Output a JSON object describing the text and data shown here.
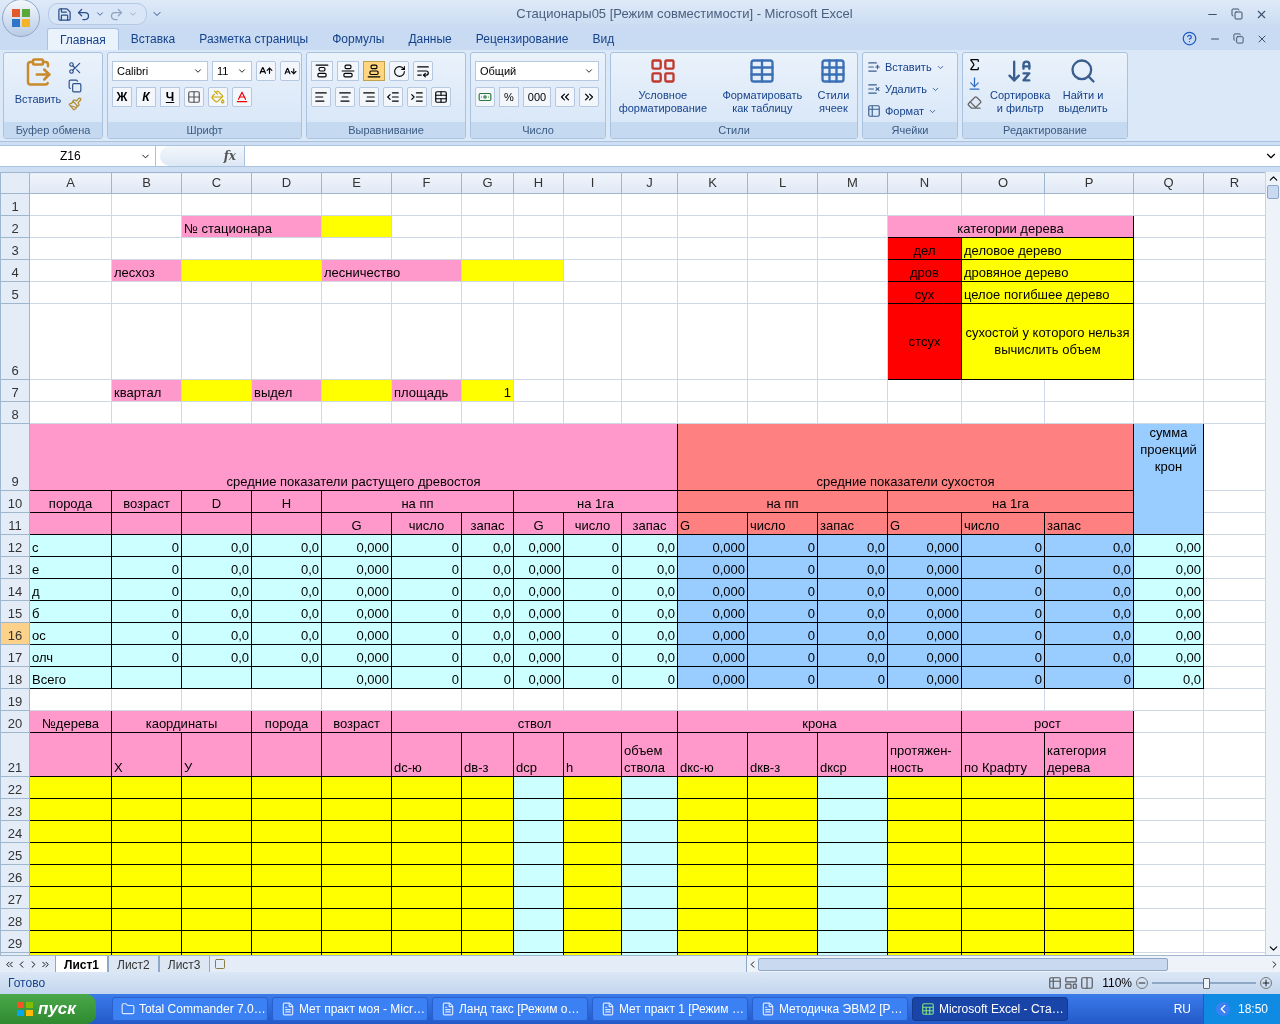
{
  "title_bar": {
    "title": "Стационары05  [Режим совместимости] - Microsoft Excel"
  },
  "ribbon_tabs": [
    {
      "label": "Главная",
      "selected": true
    },
    {
      "label": "Вставка",
      "selected": false
    },
    {
      "label": "Разметка страницы",
      "selected": false
    },
    {
      "label": "Формулы",
      "selected": false
    },
    {
      "label": "Данные",
      "selected": false
    },
    {
      "label": "Рецензирование",
      "selected": false
    },
    {
      "label": "Вид",
      "selected": false
    }
  ],
  "clipboard": {
    "title": "Буфер обмена",
    "paste": "Вставить"
  },
  "font": {
    "title": "Шрифт",
    "family": "Calibri",
    "size": "11",
    "bold": "Ж",
    "italic": "К",
    "underline": "Ч"
  },
  "alignment": {
    "title": "Выравнивание",
    "vertical": [
      {
        "selected": false
      },
      {
        "selected": false
      },
      {
        "selected": true
      }
    ]
  },
  "number": {
    "title": "Число",
    "format": "Общий",
    "percent": "%",
    "thousands": "000"
  },
  "styles": {
    "title": "Стили",
    "buttons": [
      {
        "lines": [
          "Условное",
          "форматирование"
        ]
      },
      {
        "lines": [
          "Форматировать",
          "как таблицу"
        ]
      },
      {
        "lines": [
          "Стили",
          "ячеек"
        ]
      }
    ]
  },
  "cells": {
    "title": "Ячейки",
    "buttons": [
      "Вставить",
      "Удалить",
      "Формат"
    ]
  },
  "editing": {
    "title": "Редактирование",
    "buttons": [
      {
        "lines": [
          "Сортировка",
          "и фильтр"
        ]
      },
      {
        "lines": [
          "Найти и",
          "выделить"
        ]
      }
    ]
  },
  "formula_bar": {
    "name_box": "Z16",
    "fx": "fx"
  },
  "columns": [
    "A",
    "B",
    "C",
    "D",
    "E",
    "F",
    "G",
    "H",
    "I",
    "J",
    "K",
    "L",
    "M",
    "N",
    "O",
    "P",
    "Q",
    "R"
  ],
  "rows": [
    {
      "n": "1",
      "selected": false
    },
    {
      "n": "2",
      "selected": false,
      "cells": [
        {
          "text": "№ стационара",
          "kind": "text",
          "color": "#ff99cc",
          "boxed": false
        },
        {
          "color": "#ffff00",
          "boxed": false
        },
        {
          "text": "категории дерева",
          "kind": "head",
          "color": "#ff99cc",
          "boxed": true
        }
      ]
    },
    {
      "n": "3",
      "selected": false,
      "cells": [
        {
          "text": "дел",
          "kind": "head",
          "color": "#ff0000",
          "boxed": true
        },
        {
          "text": "деловое дерево",
          "kind": "text",
          "color": "#ffff00",
          "boxed": true
        }
      ]
    },
    {
      "n": "4",
      "selected": false,
      "cells": [
        {
          "text": "лесхоз",
          "kind": "text",
          "color": "#ff99cc",
          "boxed": false
        },
        {
          "color": "#ffff00",
          "boxed": false
        },
        {
          "text": "лесничество",
          "kind": "text",
          "color": "#ff99cc",
          "boxed": false
        },
        {
          "color": "#ffff00",
          "boxed": false
        },
        {
          "text": "дров",
          "kind": "head",
          "color": "#ff0000",
          "boxed": true
        },
        {
          "text": "дровяное дерево",
          "kind": "text",
          "color": "#ffff00",
          "boxed": true
        }
      ]
    },
    {
      "n": "5",
      "selected": false,
      "cells": [
        {
          "text": "сух",
          "kind": "head",
          "color": "#ff0000",
          "boxed": true
        },
        {
          "text": "целое погибшее дерево",
          "kind": "text",
          "color": "#ffff00",
          "boxed": true
        }
      ]
    },
    {
      "n": "6",
      "selected": false,
      "cells": [
        {
          "text": "стсух",
          "kind": "note",
          "color": "#ff0000",
          "boxed": true
        },
        {
          "text": "сухостой у которого нельзя вычислить объем",
          "kind": "note",
          "color": "#ffff00",
          "boxed": true
        }
      ]
    },
    {
      "n": "7",
      "selected": false,
      "cells": [
        {
          "text": "квартал",
          "kind": "text",
          "color": "#ff99cc",
          "boxed": false
        },
        {
          "color": "#ffff00",
          "boxed": false
        },
        {
          "text": "выдел",
          "kind": "text",
          "color": "#ff99cc",
          "boxed": false
        },
        {
          "color": "#ffff00",
          "boxed": false
        },
        {
          "text": "площадь",
          "kind": "text",
          "color": "#ff99cc",
          "boxed": false
        },
        {
          "text": "1",
          "kind": "num",
          "color": "#ffff00",
          "boxed": false
        }
      ]
    },
    {
      "n": "8",
      "selected": false
    },
    {
      "n": "9",
      "selected": false,
      "cells": [
        {
          "text": "средние показатели растущего древостоя",
          "kind": "head",
          "color": "#ff99cc",
          "boxed": true
        },
        {
          "text": "средние показатели сухостоя",
          "kind": "head",
          "color": "#ff8080",
          "boxed": true
        },
        {
          "text": "сумма проекций крон",
          "kind": "top",
          "color": "#99ccff",
          "boxed": true
        }
      ]
    },
    {
      "n": "10",
      "selected": false,
      "cells": [
        {
          "text": "порода",
          "kind": "head",
          "color": "#ff99cc",
          "boxed": true
        },
        {
          "text": "возраст",
          "kind": "head",
          "color": "#ff99cc",
          "boxed": true
        },
        {
          "text": "D",
          "kind": "head",
          "color": "#ff99cc",
          "boxed": true
        },
        {
          "text": "H",
          "kind": "head",
          "color": "#ff99cc",
          "boxed": true
        },
        {
          "text": "на пп",
          "kind": "head",
          "color": "#ff99cc",
          "boxed": true
        },
        {
          "text": "на 1га",
          "kind": "head",
          "color": "#ff99cc",
          "boxed": true
        },
        {
          "text": "на пп",
          "kind": "head",
          "color": "#ff8080",
          "boxed": true
        },
        {
          "text": "на 1га",
          "kind": "head",
          "color": "#ff8080",
          "boxed": true
        }
      ]
    },
    {
      "n": "11",
      "selected": false,
      "cells": [
        {
          "color": "#ff99cc",
          "boxed": true
        },
        {
          "color": "#ff99cc",
          "boxed": true
        },
        {
          "color": "#ff99cc",
          "boxed": true
        },
        {
          "color": "#ff99cc",
          "boxed": true
        },
        {
          "text": "G",
          "kind": "head",
          "color": "#ff99cc",
          "boxed": true
        },
        {
          "text": "число",
          "kind": "head",
          "color": "#ff99cc",
          "boxed": true
        },
        {
          "text": "запас",
          "kind": "head",
          "color": "#ff99cc",
          "boxed": true
        },
        {
          "text": "G",
          "kind": "head",
          "color": "#ff99cc",
          "boxed": true
        },
        {
          "text": "число",
          "kind": "head",
          "color": "#ff99cc",
          "boxed": true
        },
        {
          "text": "запас",
          "kind": "head",
          "color": "#ff99cc",
          "boxed": true
        },
        {
          "text": "G",
          "kind": "text",
          "color": "#ff8080",
          "boxed": true
        },
        {
          "text": "число",
          "kind": "text",
          "color": "#ff8080",
          "boxed": true
        },
        {
          "text": "запас",
          "kind": "text",
          "color": "#ff8080",
          "boxed": true
        },
        {
          "text": "G",
          "kind": "text",
          "color": "#ff8080",
          "boxed": true
        },
        {
          "text": "число",
          "kind": "text",
          "color": "#ff8080",
          "boxed": true
        },
        {
          "text": "запас",
          "kind": "text",
          "color": "#ff8080",
          "boxed": true
        }
      ]
    },
    {
      "n": "12",
      "selected": false,
      "cells": [
        {
          "text": "с",
          "kind": "text",
          "color": "#ccffff",
          "boxed": true
        },
        {
          "text": "0",
          "kind": "num",
          "color": "#ccffff",
          "boxed": true
        },
        {
          "text": "0,0",
          "kind": "num",
          "color": "#ccffff",
          "boxed": true
        },
        {
          "text": "0,0",
          "kind": "num",
          "color": "#ccffff",
          "boxed": true
        },
        {
          "text": "0,000",
          "kind": "num",
          "color": "#ccffff",
          "boxed": true
        },
        {
          "text": "0",
          "kind": "num",
          "color": "#ccffff",
          "boxed": true
        },
        {
          "text": "0,0",
          "kind": "num",
          "color": "#ccffff",
          "boxed": true
        },
        {
          "text": "0,000",
          "kind": "num",
          "color": "#ccffff",
          "boxed": true
        },
        {
          "text": "0",
          "kind": "num",
          "color": "#ccffff",
          "boxed": true
        },
        {
          "text": "0,0",
          "kind": "num",
          "color": "#ccffff",
          "boxed": true
        },
        {
          "text": "0,000",
          "kind": "num",
          "color": "#99ccff",
          "boxed": true
        },
        {
          "text": "0",
          "kind": "num",
          "color": "#99ccff",
          "boxed": true
        },
        {
          "text": "0,0",
          "kind": "num",
          "color": "#99ccff",
          "boxed": true
        },
        {
          "text": "0,000",
          "kind": "num",
          "color": "#99ccff",
          "boxed": true
        },
        {
          "text": "0",
          "kind": "num",
          "color": "#99ccff",
          "boxed": true
        },
        {
          "text": "0,0",
          "kind": "num",
          "color": "#99ccff",
          "boxed": true
        },
        {
          "text": "0,00",
          "kind": "num",
          "color": "#ccffff",
          "boxed": true
        }
      ]
    },
    {
      "n": "13",
      "selected": false,
      "cells": [
        {
          "text": "е",
          "kind": "text",
          "color": "#ccffff",
          "boxed": true
        },
        {
          "text": "0",
          "kind": "num",
          "color": "#ccffff",
          "boxed": true
        },
        {
          "text": "0,0",
          "kind": "num",
          "color": "#ccffff",
          "boxed": true
        },
        {
          "text": "0,0",
          "kind": "num",
          "color": "#ccffff",
          "boxed": true
        },
        {
          "text": "0,000",
          "kind": "num",
          "color": "#ccffff",
          "boxed": true
        },
        {
          "text": "0",
          "kind": "num",
          "color": "#ccffff",
          "boxed": true
        },
        {
          "text": "0,0",
          "kind": "num",
          "color": "#ccffff",
          "boxed": true
        },
        {
          "text": "0,000",
          "kind": "num",
          "color": "#ccffff",
          "boxed": true
        },
        {
          "text": "0",
          "kind": "num",
          "color": "#ccffff",
          "boxed": true
        },
        {
          "text": "0,0",
          "kind": "num",
          "color": "#ccffff",
          "boxed": true
        },
        {
          "text": "0,000",
          "kind": "num",
          "color": "#99ccff",
          "boxed": true
        },
        {
          "text": "0",
          "kind": "num",
          "color": "#99ccff",
          "boxed": true
        },
        {
          "text": "0,0",
          "kind": "num",
          "color": "#99ccff",
          "boxed": true
        },
        {
          "text": "0,000",
          "kind": "num",
          "color": "#99ccff",
          "boxed": true
        },
        {
          "text": "0",
          "kind": "num",
          "color": "#99ccff",
          "boxed": true
        },
        {
          "text": "0,0",
          "kind": "num",
          "color": "#99ccff",
          "boxed": true
        },
        {
          "text": "0,00",
          "kind": "num",
          "color": "#ccffff",
          "boxed": true
        }
      ]
    },
    {
      "n": "14",
      "selected": false,
      "cells": [
        {
          "text": "д",
          "kind": "text",
          "color": "#ccffff",
          "boxed": true
        },
        {
          "text": "0",
          "kind": "num",
          "color": "#ccffff",
          "boxed": true
        },
        {
          "text": "0,0",
          "kind": "num",
          "color": "#ccffff",
          "boxed": true
        },
        {
          "text": "0,0",
          "kind": "num",
          "color": "#ccffff",
          "boxed": true
        },
        {
          "text": "0,000",
          "kind": "num",
          "color": "#ccffff",
          "boxed": true
        },
        {
          "text": "0",
          "kind": "num",
          "color": "#ccffff",
          "boxed": true
        },
        {
          "text": "0,0",
          "kind": "num",
          "color": "#ccffff",
          "boxed": true
        },
        {
          "text": "0,000",
          "kind": "num",
          "color": "#ccffff",
          "boxed": true
        },
        {
          "text": "0",
          "kind": "num",
          "color": "#ccffff",
          "boxed": true
        },
        {
          "text": "0,0",
          "kind": "num",
          "color": "#ccffff",
          "boxed": true
        },
        {
          "text": "0,000",
          "kind": "num",
          "color": "#99ccff",
          "boxed": true
        },
        {
          "text": "0",
          "kind": "num",
          "color": "#99ccff",
          "boxed": true
        },
        {
          "text": "0,0",
          "kind": "num",
          "color": "#99ccff",
          "boxed": true
        },
        {
          "text": "0,000",
          "kind": "num",
          "color": "#99ccff",
          "boxed": true
        },
        {
          "text": "0",
          "kind": "num",
          "color": "#99ccff",
          "boxed": true
        },
        {
          "text": "0,0",
          "kind": "num",
          "color": "#99ccff",
          "boxed": true
        },
        {
          "text": "0,00",
          "kind": "num",
          "color": "#ccffff",
          "boxed": true
        }
      ]
    },
    {
      "n": "15",
      "selected": false,
      "cells": [
        {
          "text": "б",
          "kind": "text",
          "color": "#ccffff",
          "boxed": true
        },
        {
          "text": "0",
          "kind": "num",
          "color": "#ccffff",
          "boxed": true
        },
        {
          "text": "0,0",
          "kind": "num",
          "color": "#ccffff",
          "boxed": true
        },
        {
          "text": "0,0",
          "kind": "num",
          "color": "#ccffff",
          "boxed": true
        },
        {
          "text": "0,000",
          "kind": "num",
          "color": "#ccffff",
          "boxed": true
        },
        {
          "text": "0",
          "kind": "num",
          "color": "#ccffff",
          "boxed": true
        },
        {
          "text": "0,0",
          "kind": "num",
          "color": "#ccffff",
          "boxed": true
        },
        {
          "text": "0,000",
          "kind": "num",
          "color": "#ccffff",
          "boxed": true
        },
        {
          "text": "0",
          "kind": "num",
          "color": "#ccffff",
          "boxed": true
        },
        {
          "text": "0,0",
          "kind": "num",
          "color": "#ccffff",
          "boxed": true
        },
        {
          "text": "0,000",
          "kind": "num",
          "color": "#99ccff",
          "boxed": true
        },
        {
          "text": "0",
          "kind": "num",
          "color": "#99ccff",
          "boxed": true
        },
        {
          "text": "0,0",
          "kind": "num",
          "color": "#99ccff",
          "boxed": true
        },
        {
          "text": "0,000",
          "kind": "num",
          "color": "#99ccff",
          "boxed": true
        },
        {
          "text": "0",
          "kind": "num",
          "color": "#99ccff",
          "boxed": true
        },
        {
          "text": "0,0",
          "kind": "num",
          "color": "#99ccff",
          "boxed": true
        },
        {
          "text": "0,00",
          "kind": "num",
          "color": "#ccffff",
          "boxed": true
        }
      ]
    },
    {
      "n": "16",
      "selected": true,
      "cells": [
        {
          "text": "ос",
          "kind": "text",
          "color": "#ccffff",
          "boxed": true
        },
        {
          "text": "0",
          "kind": "num",
          "color": "#ccffff",
          "boxed": true
        },
        {
          "text": "0,0",
          "kind": "num",
          "color": "#ccffff",
          "boxed": true
        },
        {
          "text": "0,0",
          "kind": "num",
          "color": "#ccffff",
          "boxed": true
        },
        {
          "text": "0,000",
          "kind": "num",
          "color": "#ccffff",
          "boxed": true
        },
        {
          "text": "0",
          "kind": "num",
          "color": "#ccffff",
          "boxed": true
        },
        {
          "text": "0,0",
          "kind": "num",
          "color": "#ccffff",
          "boxed": true
        },
        {
          "text": "0,000",
          "kind": "num",
          "color": "#ccffff",
          "boxed": true
        },
        {
          "text": "0",
          "kind": "num",
          "color": "#ccffff",
          "boxed": true
        },
        {
          "text": "0,0",
          "kind": "num",
          "color": "#ccffff",
          "boxed": true
        },
        {
          "text": "0,000",
          "kind": "num",
          "color": "#99ccff",
          "boxed": true
        },
        {
          "text": "0",
          "kind": "num",
          "color": "#99ccff",
          "boxed": true
        },
        {
          "text": "0,0",
          "kind": "num",
          "color": "#99ccff",
          "boxed": true
        },
        {
          "text": "0,000",
          "kind": "num",
          "color": "#99ccff",
          "boxed": true
        },
        {
          "text": "0",
          "kind": "num",
          "color": "#99ccff",
          "boxed": true
        },
        {
          "text": "0,0",
          "kind": "num",
          "color": "#99ccff",
          "boxed": true
        },
        {
          "text": "0,00",
          "kind": "num",
          "color": "#ccffff",
          "boxed": true
        }
      ]
    },
    {
      "n": "17",
      "selected": false,
      "cells": [
        {
          "text": "олч",
          "kind": "text",
          "color": "#ccffff",
          "boxed": true
        },
        {
          "text": "0",
          "kind": "num",
          "color": "#ccffff",
          "boxed": true
        },
        {
          "text": "0,0",
          "kind": "num",
          "color": "#ccffff",
          "boxed": true
        },
        {
          "text": "0,0",
          "kind": "num",
          "color": "#ccffff",
          "boxed": true
        },
        {
          "text": "0,000",
          "kind": "num",
          "color": "#ccffff",
          "boxed": true
        },
        {
          "text": "0",
          "kind": "num",
          "color": "#ccffff",
          "boxed": true
        },
        {
          "text": "0,0",
          "kind": "num",
          "color": "#ccffff",
          "boxed": true
        },
        {
          "text": "0,000",
          "kind": "num",
          "color": "#ccffff",
          "boxed": true
        },
        {
          "text": "0",
          "kind": "num",
          "color": "#ccffff",
          "boxed": true
        },
        {
          "text": "0,0",
          "kind": "num",
          "color": "#ccffff",
          "boxed": true
        },
        {
          "text": "0,000",
          "kind": "num",
          "color": "#99ccff",
          "boxed": true
        },
        {
          "text": "0",
          "kind": "num",
          "color": "#99ccff",
          "boxed": true
        },
        {
          "text": "0,0",
          "kind": "num",
          "color": "#99ccff",
          "boxed": true
        },
        {
          "text": "0,000",
          "kind": "num",
          "color": "#99ccff",
          "boxed": true
        },
        {
          "text": "0",
          "kind": "num",
          "color": "#99ccff",
          "boxed": true
        },
        {
          "text": "0,0",
          "kind": "num",
          "color": "#99ccff",
          "boxed": true
        },
        {
          "text": "0,00",
          "kind": "num",
          "color": "#ccffff",
          "boxed": true
        }
      ]
    },
    {
      "n": "18",
      "selected": false,
      "cells": [
        {
          "text": "Всего",
          "kind": "text",
          "color": "#ccffff",
          "boxed": true
        },
        {
          "color": "#ccffff",
          "boxed": true
        },
        {
          "color": "#ccffff",
          "boxed": true
        },
        {
          "color": "#ccffff",
          "boxed": true
        },
        {
          "text": "0,000",
          "kind": "num",
          "color": "#ccffff",
          "boxed": true
        },
        {
          "text": "0",
          "kind": "num",
          "color": "#ccffff",
          "boxed": true
        },
        {
          "text": "0",
          "kind": "num",
          "color": "#ccffff",
          "boxed": true
        },
        {
          "text": "0,000",
          "kind": "num",
          "color": "#ccffff",
          "boxed": true
        },
        {
          "text": "0",
          "kind": "num",
          "color": "#ccffff",
          "boxed": true
        },
        {
          "text": "0",
          "kind": "num",
          "color": "#ccffff",
          "boxed": true
        },
        {
          "text": "0,000",
          "kind": "num",
          "color": "#99ccff",
          "boxed": true
        },
        {
          "text": "0",
          "kind": "num",
          "color": "#99ccff",
          "boxed": true
        },
        {
          "text": "0",
          "kind": "num",
          "color": "#99ccff",
          "boxed": true
        },
        {
          "text": "0,000",
          "kind": "num",
          "color": "#99ccff",
          "boxed": true
        },
        {
          "text": "0",
          "kind": "num",
          "color": "#99ccff",
          "boxed": true
        },
        {
          "text": "0",
          "kind": "num",
          "color": "#99ccff",
          "boxed": true
        },
        {
          "text": "0,0",
          "kind": "num",
          "color": "#ccffff",
          "boxed": true
        }
      ]
    },
    {
      "n": "19",
      "selected": false
    },
    {
      "n": "20",
      "selected": false,
      "cells": [
        {
          "text": "№дерева",
          "kind": "head",
          "color": "#ff99cc",
          "boxed": true
        },
        {
          "text": "каординаты",
          "kind": "head",
          "color": "#ff99cc",
          "boxed": true
        },
        {
          "text": "порода",
          "kind": "head",
          "color": "#ff99cc",
          "boxed": true
        },
        {
          "text": "возраст",
          "kind": "head",
          "color": "#ff99cc",
          "boxed": true
        },
        {
          "text": "ствол",
          "kind": "head",
          "color": "#ff99cc",
          "boxed": true
        },
        {
          "text": "крона",
          "kind": "head",
          "color": "#ff99cc",
          "boxed": true
        },
        {
          "text": "рост",
          "kind": "head",
          "color": "#ff99cc",
          "boxed": true
        }
      ]
    },
    {
      "n": "21",
      "selected": false,
      "cells": [
        {
          "color": "#ff99cc",
          "boxed": true
        },
        {
          "text": "X",
          "kind": "text",
          "color": "#ff99cc",
          "boxed": true
        },
        {
          "text": "У",
          "kind": "text",
          "color": "#ff99cc",
          "boxed": true
        },
        {
          "color": "#ff99cc",
          "boxed": true
        },
        {
          "color": "#ff99cc",
          "boxed": true
        },
        {
          "text": "dc-ю",
          "kind": "text",
          "color": "#ff99cc",
          "boxed": true
        },
        {
          "text": "dв-з",
          "kind": "text",
          "color": "#ff99cc",
          "boxed": true
        },
        {
          "text": "dср",
          "kind": "text",
          "color": "#ff99cc",
          "boxed": true
        },
        {
          "text": "h",
          "kind": "text",
          "color": "#ff99cc",
          "boxed": true
        },
        {
          "text": "объем ствола",
          "kind": "text",
          "color": "#ff99cc",
          "boxed": true
        },
        {
          "text": "dкс-ю",
          "kind": "text",
          "color": "#ff99cc",
          "boxed": true
        },
        {
          "text": "dкв-з",
          "kind": "text",
          "color": "#ff99cc",
          "boxed": true
        },
        {
          "text": "dкср",
          "kind": "text",
          "color": "#ff99cc",
          "boxed": true
        },
        {
          "text": "протяжен-ность",
          "kind": "text",
          "color": "#ff99cc",
          "boxed": true
        },
        {
          "text": "по Крафту",
          "kind": "text",
          "color": "#ff99cc",
          "boxed": true
        },
        {
          "text": "категория дерева",
          "kind": "text",
          "color": "#ff99cc",
          "boxed": true
        }
      ]
    },
    {
      "n": "22",
      "selected": false,
      "cells": [
        {
          "color": "#ffff00",
          "boxed": true
        },
        {
          "color": "#ffff00",
          "boxed": true
        },
        {
          "color": "#ffff00",
          "boxed": true
        },
        {
          "color": "#ffff00",
          "boxed": true
        },
        {
          "color": "#ffff00",
          "boxed": true
        },
        {
          "color": "#ffff00",
          "boxed": true
        },
        {
          "color": "#ffff00",
          "boxed": true
        },
        {
          "color": "#ccffff",
          "boxed": true
        },
        {
          "color": "#ffff00",
          "boxed": true
        },
        {
          "color": "#ccffff",
          "boxed": true
        },
        {
          "color": "#ffff00",
          "boxed": true
        },
        {
          "color": "#ffff00",
          "boxed": true
        },
        {
          "color": "#ccffff",
          "boxed": true
        },
        {
          "color": "#ffff00",
          "boxed": true
        },
        {
          "color": "#ffff00",
          "boxed": true
        },
        {
          "color": "#ffff00",
          "boxed": true
        }
      ]
    },
    {
      "n": "23",
      "selected": false,
      "cells": [
        {
          "color": "#ffff00",
          "boxed": true
        },
        {
          "color": "#ffff00",
          "boxed": true
        },
        {
          "color": "#ffff00",
          "boxed": true
        },
        {
          "color": "#ffff00",
          "boxed": true
        },
        {
          "color": "#ffff00",
          "boxed": true
        },
        {
          "color": "#ffff00",
          "boxed": true
        },
        {
          "color": "#ffff00",
          "boxed": true
        },
        {
          "color": "#ccffff",
          "boxed": true
        },
        {
          "color": "#ffff00",
          "boxed": true
        },
        {
          "color": "#ccffff",
          "boxed": true
        },
        {
          "color": "#ffff00",
          "boxed": true
        },
        {
          "color": "#ffff00",
          "boxed": true
        },
        {
          "color": "#ccffff",
          "boxed": true
        },
        {
          "color": "#ffff00",
          "boxed": true
        },
        {
          "color": "#ffff00",
          "boxed": true
        },
        {
          "color": "#ffff00",
          "boxed": true
        }
      ]
    },
    {
      "n": "24",
      "selected": false,
      "cells": [
        {
          "color": "#ffff00",
          "boxed": true
        },
        {
          "color": "#ffff00",
          "boxed": true
        },
        {
          "color": "#ffff00",
          "boxed": true
        },
        {
          "color": "#ffff00",
          "boxed": true
        },
        {
          "color": "#ffff00",
          "boxed": true
        },
        {
          "color": "#ffff00",
          "boxed": true
        },
        {
          "color": "#ffff00",
          "boxed": true
        },
        {
          "color": "#ccffff",
          "boxed": true
        },
        {
          "color": "#ffff00",
          "boxed": true
        },
        {
          "color": "#ccffff",
          "boxed": true
        },
        {
          "color": "#ffff00",
          "boxed": true
        },
        {
          "color": "#ffff00",
          "boxed": true
        },
        {
          "color": "#ccffff",
          "boxed": true
        },
        {
          "color": "#ffff00",
          "boxed": true
        },
        {
          "color": "#ffff00",
          "boxed": true
        },
        {
          "color": "#ffff00",
          "boxed": true
        }
      ]
    },
    {
      "n": "25",
      "selected": false,
      "cells": [
        {
          "color": "#ffff00",
          "boxed": true
        },
        {
          "color": "#ffff00",
          "boxed": true
        },
        {
          "color": "#ffff00",
          "boxed": true
        },
        {
          "color": "#ffff00",
          "boxed": true
        },
        {
          "color": "#ffff00",
          "boxed": true
        },
        {
          "color": "#ffff00",
          "boxed": true
        },
        {
          "color": "#ffff00",
          "boxed": true
        },
        {
          "color": "#ccffff",
          "boxed": true
        },
        {
          "color": "#ffff00",
          "boxed": true
        },
        {
          "color": "#ccffff",
          "boxed": true
        },
        {
          "color": "#ffff00",
          "boxed": true
        },
        {
          "color": "#ffff00",
          "boxed": true
        },
        {
          "color": "#ccffff",
          "boxed": true
        },
        {
          "color": "#ffff00",
          "boxed": true
        },
        {
          "color": "#ffff00",
          "boxed": true
        },
        {
          "color": "#ffff00",
          "boxed": true
        }
      ]
    },
    {
      "n": "26",
      "selected": false,
      "cells": [
        {
          "color": "#ffff00",
          "boxed": true
        },
        {
          "color": "#ffff00",
          "boxed": true
        },
        {
          "color": "#ffff00",
          "boxed": true
        },
        {
          "color": "#ffff00",
          "boxed": true
        },
        {
          "color": "#ffff00",
          "boxed": true
        },
        {
          "color": "#ffff00",
          "boxed": true
        },
        {
          "color": "#ffff00",
          "boxed": true
        },
        {
          "color": "#ccffff",
          "boxed": true
        },
        {
          "color": "#ffff00",
          "boxed": true
        },
        {
          "color": "#ccffff",
          "boxed": true
        },
        {
          "color": "#ffff00",
          "boxed": true
        },
        {
          "color": "#ffff00",
          "boxed": true
        },
        {
          "color": "#ccffff",
          "boxed": true
        },
        {
          "color": "#ffff00",
          "boxed": true
        },
        {
          "color": "#ffff00",
          "boxed": true
        },
        {
          "color": "#ffff00",
          "boxed": true
        }
      ]
    },
    {
      "n": "27",
      "selected": false,
      "cells": [
        {
          "color": "#ffff00",
          "boxed": true
        },
        {
          "color": "#ffff00",
          "boxed": true
        },
        {
          "color": "#ffff00",
          "boxed": true
        },
        {
          "color": "#ffff00",
          "boxed": true
        },
        {
          "color": "#ffff00",
          "boxed": true
        },
        {
          "color": "#ffff00",
          "boxed": true
        },
        {
          "color": "#ffff00",
          "boxed": true
        },
        {
          "color": "#ccffff",
          "boxed": true
        },
        {
          "color": "#ffff00",
          "boxed": true
        },
        {
          "color": "#ccffff",
          "boxed": true
        },
        {
          "color": "#ffff00",
          "boxed": true
        },
        {
          "color": "#ffff00",
          "boxed": true
        },
        {
          "color": "#ccffff",
          "boxed": true
        },
        {
          "color": "#ffff00",
          "boxed": true
        },
        {
          "color": "#ffff00",
          "boxed": true
        },
        {
          "color": "#ffff00",
          "boxed": true
        }
      ]
    },
    {
      "n": "28",
      "selected": false,
      "cells": [
        {
          "color": "#ffff00",
          "boxed": true
        },
        {
          "color": "#ffff00",
          "boxed": true
        },
        {
          "color": "#ffff00",
          "boxed": true
        },
        {
          "color": "#ffff00",
          "boxed": true
        },
        {
          "color": "#ffff00",
          "boxed": true
        },
        {
          "color": "#ffff00",
          "boxed": true
        },
        {
          "color": "#ffff00",
          "boxed": true
        },
        {
          "color": "#ccffff",
          "boxed": true
        },
        {
          "color": "#ffff00",
          "boxed": true
        },
        {
          "color": "#ccffff",
          "boxed": true
        },
        {
          "color": "#ffff00",
          "boxed": true
        },
        {
          "color": "#ffff00",
          "boxed": true
        },
        {
          "color": "#ccffff",
          "boxed": true
        },
        {
          "color": "#ffff00",
          "boxed": true
        },
        {
          "color": "#ffff00",
          "boxed": true
        },
        {
          "color": "#ffff00",
          "boxed": true
        }
      ]
    },
    {
      "n": "29",
      "selected": false,
      "cells": [
        {
          "color": "#ffff00",
          "boxed": true
        },
        {
          "color": "#ffff00",
          "boxed": true
        },
        {
          "color": "#ffff00",
          "boxed": true
        },
        {
          "color": "#ffff00",
          "boxed": true
        },
        {
          "color": "#ffff00",
          "boxed": true
        },
        {
          "color": "#ffff00",
          "boxed": true
        },
        {
          "color": "#ffff00",
          "boxed": true
        },
        {
          "color": "#ccffff",
          "boxed": true
        },
        {
          "color": "#ffff00",
          "boxed": true
        },
        {
          "color": "#ccffff",
          "boxed": true
        },
        {
          "color": "#ffff00",
          "boxed": true
        },
        {
          "color": "#ffff00",
          "boxed": true
        },
        {
          "color": "#ccffff",
          "boxed": true
        },
        {
          "color": "#ffff00",
          "boxed": true
        },
        {
          "color": "#ffff00",
          "boxed": true
        },
        {
          "color": "#ffff00",
          "boxed": true
        }
      ]
    },
    {
      "selected": false,
      "cells": [
        {
          "color": "#ffff00",
          "boxed": true
        },
        {
          "color": "#ffff00",
          "boxed": true
        },
        {
          "color": "#ffff00",
          "boxed": true
        },
        {
          "color": "#ffff00",
          "boxed": true
        },
        {
          "color": "#ffff00",
          "boxed": true
        },
        {
          "color": "#ffff00",
          "boxed": true
        },
        {
          "color": "#ffff00",
          "boxed": true
        },
        {
          "color": "#ccffff",
          "boxed": true
        },
        {
          "color": "#ffff00",
          "boxed": true
        },
        {
          "color": "#ccffff",
          "boxed": true
        },
        {
          "color": "#ffff00",
          "boxed": true
        },
        {
          "color": "#ffff00",
          "boxed": true
        },
        {
          "color": "#ccffff",
          "boxed": true
        },
        {
          "color": "#ffff00",
          "boxed": true
        },
        {
          "color": "#ffff00",
          "boxed": true
        },
        {
          "color": "#ffff00",
          "boxed": true
        }
      ]
    }
  ],
  "sheet_tabs": [
    {
      "label": "Лист1",
      "selected": true
    },
    {
      "label": "Лист2",
      "selected": false
    },
    {
      "label": "Лист3",
      "selected": false
    }
  ],
  "status_bar": {
    "status": "Готово",
    "zoom": "110%",
    "level": 0.52
  },
  "taskbar": {
    "start": "пуск",
    "items": [
      {
        "label": "Total Commander 7.0…",
        "kind": "commander",
        "selected": false
      },
      {
        "label": "Мет практ моя - Micr…",
        "kind": "word",
        "selected": false
      },
      {
        "label": "Ланд такс [Режим о…",
        "kind": "word",
        "selected": false
      },
      {
        "label": "Мет практ 1 [Режим …",
        "kind": "word",
        "selected": false
      },
      {
        "label": "Методичка ЭВМ2 [Р…",
        "kind": "word",
        "selected": false
      },
      {
        "label": "Microsoft Excel - Ста…",
        "kind": "excel",
        "selected": true
      }
    ],
    "language": "RU",
    "time": "18:50"
  }
}
